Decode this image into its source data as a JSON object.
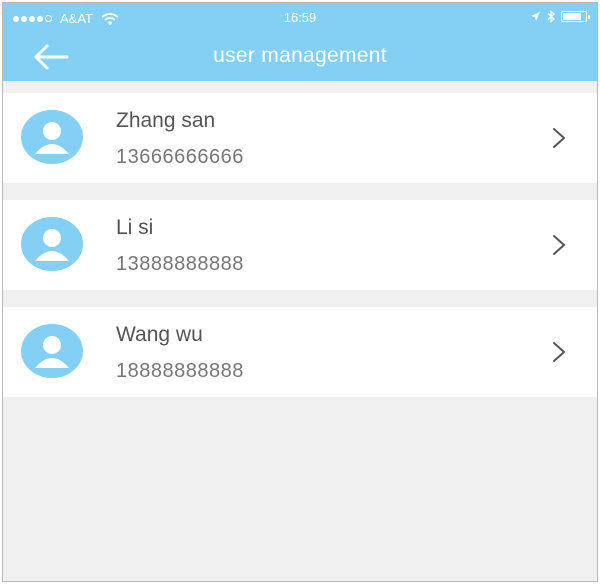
{
  "status_bar": {
    "carrier": "A&AT",
    "time": "16:59"
  },
  "header": {
    "title": "user management"
  },
  "users": [
    {
      "name": "Zhang san",
      "phone": "13666666666"
    },
    {
      "name": "Li si",
      "phone": "13888888888"
    },
    {
      "name": "Wang wu",
      "phone": "18888888888"
    }
  ],
  "colors": {
    "header_bg": "#84d0f4",
    "avatar": "#84d0f4",
    "page_bg": "#f0f0f0"
  },
  "icons": {
    "back": "arrow-left-icon",
    "avatar": "user-avatar-icon",
    "chevron": "chevron-right-icon",
    "wifi": "wifi-icon",
    "location": "location-arrow-icon",
    "bluetooth": "bluetooth-icon",
    "battery": "battery-icon"
  }
}
